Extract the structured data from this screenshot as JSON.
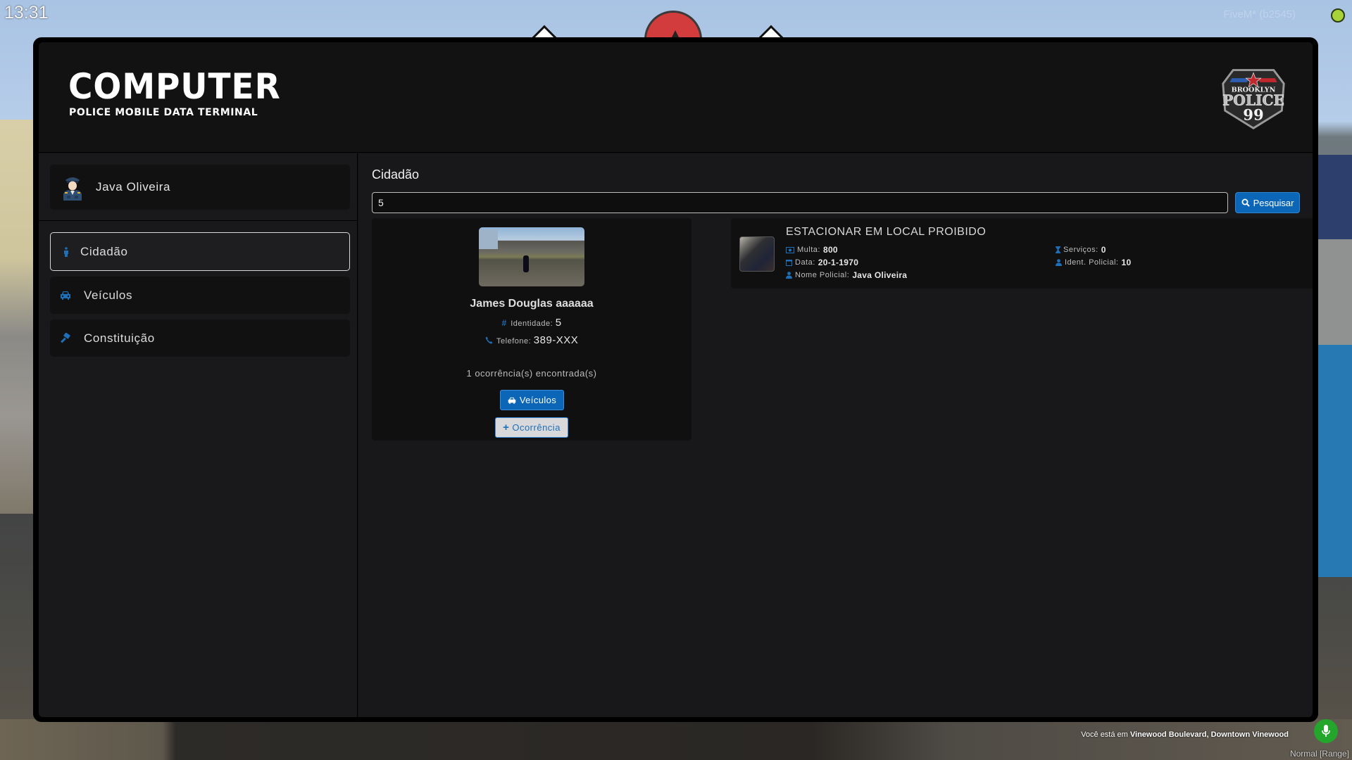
{
  "hud": {
    "clock": "13:31",
    "client_label": "FiveM* (b2545)",
    "location_prefix": "Você está em",
    "location": "Vinewood Boulevard, Downtown Vinewood",
    "voice_mode": "Normal [Range]"
  },
  "header": {
    "title": "COMPUTER",
    "subtitle": "POLICE MOBILE DATA TERMINAL",
    "badge": {
      "line1": "BROOKLYN",
      "line2": "POLICE",
      "line3": "99"
    }
  },
  "sidebar": {
    "user": {
      "name": "Java Oliveira",
      "avatar_icon": "police-officer-icon"
    },
    "items": [
      {
        "label": "Cidadão",
        "icon": "person-icon",
        "active": true
      },
      {
        "label": "Veículos",
        "icon": "car-icon",
        "active": false
      },
      {
        "label": "Constituição",
        "icon": "gavel-icon",
        "active": false
      }
    ]
  },
  "main": {
    "title": "Cidadão",
    "search": {
      "value": "5",
      "button_label": "Pesquisar",
      "button_icon": "search-icon"
    },
    "citizen": {
      "name": "James Douglas aaaaaa",
      "id_label": "Identidade:",
      "id_value": "5",
      "phone_label": "Telefone:",
      "phone_value": "389-XXX",
      "occurrences_text": "1 ocorrência(s) encontrada(s)",
      "vehicles_button": "Veículos",
      "add_occurrence_button": "Ocorrência"
    },
    "occurrences": [
      {
        "title": "ESTACIONAR EM LOCAL PROIBIDO",
        "fine_label": "Multa:",
        "fine_value": "800",
        "date_label": "Data:",
        "date_value": "20-1-1970",
        "officer_name_label": "Nome Policial:",
        "officer_name_value": "Java Oliveira",
        "services_label": "Serviços:",
        "services_value": "0",
        "officer_id_label": "Ident. Policial:",
        "officer_id_value": "10"
      }
    ]
  },
  "colors": {
    "accent": "#0b66b8",
    "icon_blue": "#1e6fb8",
    "panel": "#121213",
    "card": "#101011",
    "mic_green": "#24a52c"
  }
}
